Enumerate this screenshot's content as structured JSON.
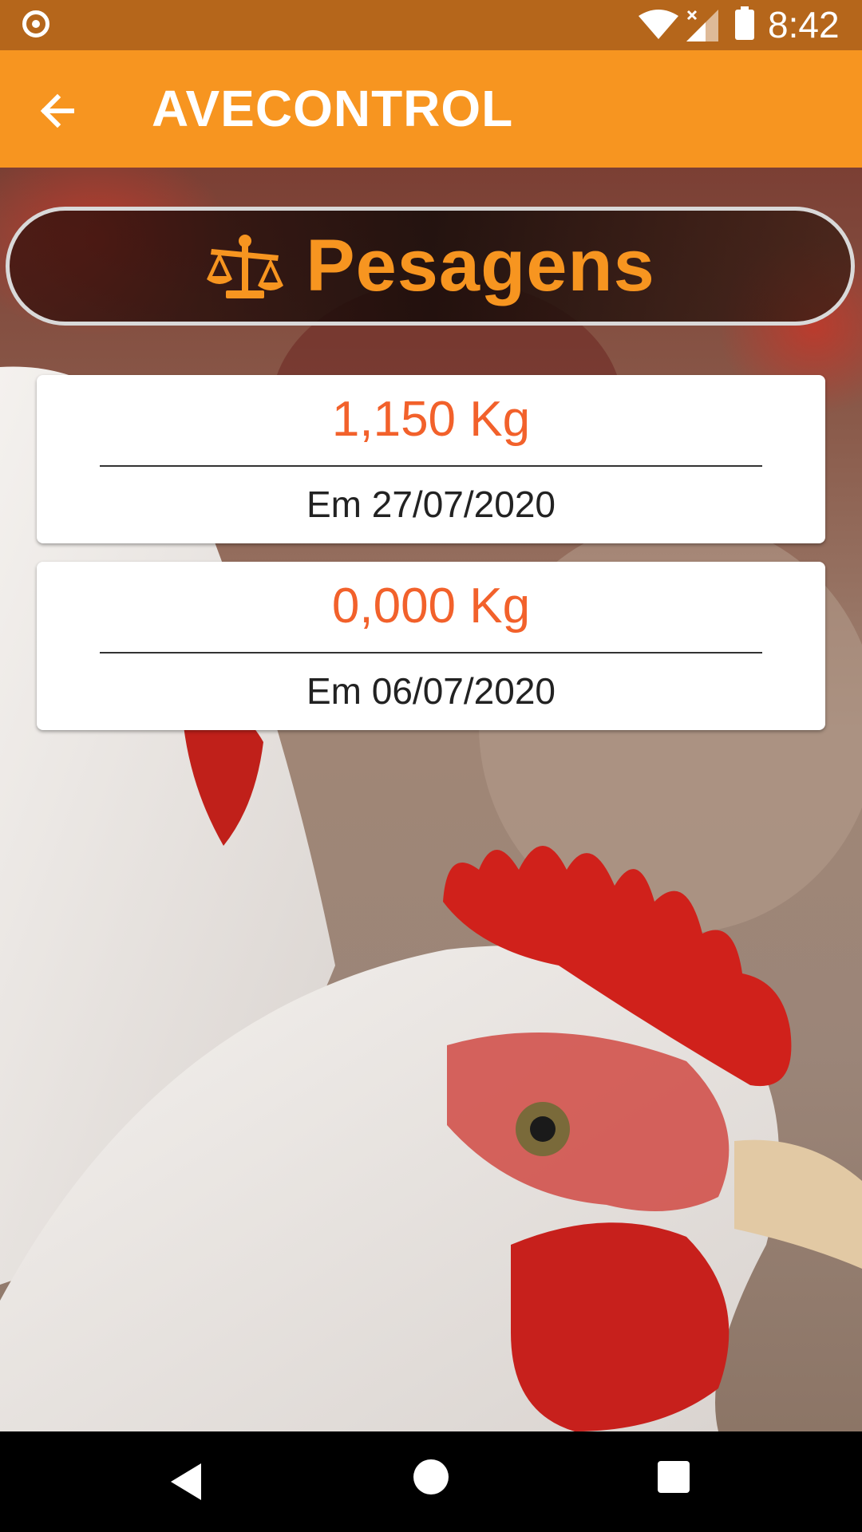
{
  "status_bar": {
    "time": "8:42",
    "icons": [
      "notification-circle-icon",
      "wifi-icon",
      "signal-icon",
      "battery-icon"
    ]
  },
  "app_bar": {
    "title": "AVECONTROL",
    "back_icon": "arrow-left-icon"
  },
  "section": {
    "title": "Pesagens",
    "icon": "scale-balance-icon"
  },
  "weighings": [
    {
      "weight": "1,150 Kg",
      "date": "Em 27/07/2020"
    },
    {
      "weight": "0,000 Kg",
      "date": "Em 06/07/2020"
    }
  ],
  "nav_bar": {
    "icons": [
      "nav-back-icon",
      "nav-home-icon",
      "nav-recents-icon"
    ]
  },
  "colors": {
    "status_bar": "#b5661b",
    "app_bar": "#f79520",
    "accent_orange": "#f79520",
    "weight_text": "#f2612b"
  }
}
